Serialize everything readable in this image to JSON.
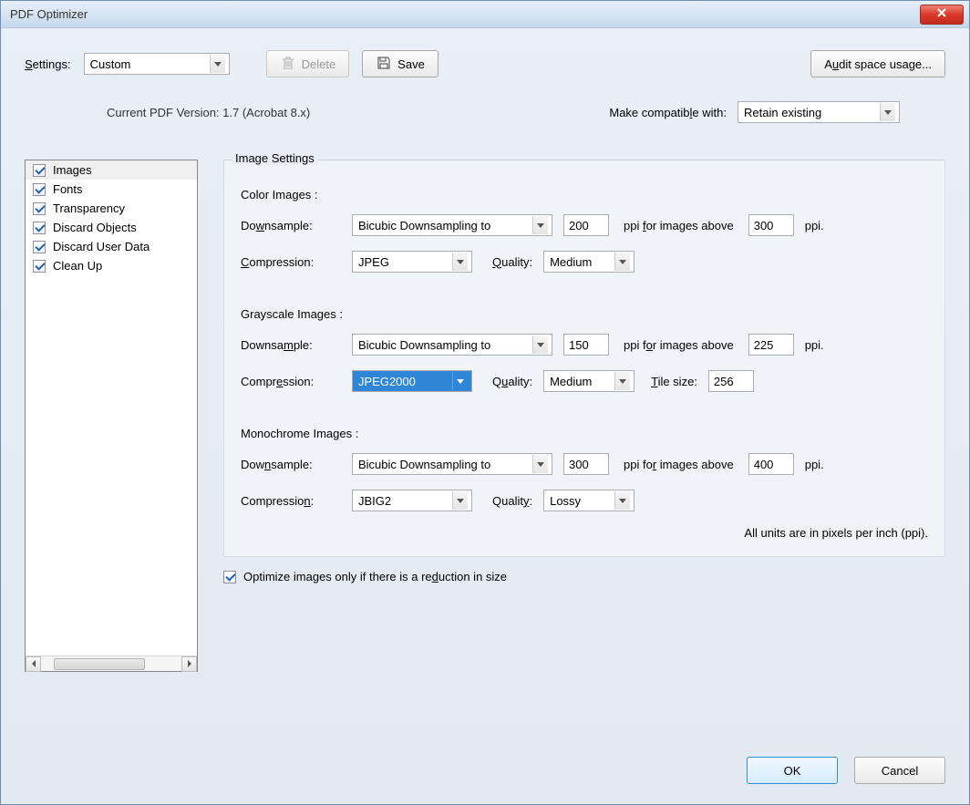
{
  "window": {
    "title": "PDF Optimizer"
  },
  "toolbar": {
    "settings_label": "Settings:",
    "settings_value": "Custom",
    "delete_label": "Delete",
    "save_label": "Save",
    "audit_label": "Audit space usage..."
  },
  "version": {
    "current_label": "Current PDF Version: 1.7 (Acrobat 8.x)",
    "compat_label": "Make compatible with:",
    "compat_value": "Retain existing"
  },
  "sidebar": {
    "items": [
      {
        "label": "Images",
        "checked": true,
        "selected": true
      },
      {
        "label": "Fonts",
        "checked": true,
        "selected": false
      },
      {
        "label": "Transparency",
        "checked": true,
        "selected": false
      },
      {
        "label": "Discard Objects",
        "checked": true,
        "selected": false
      },
      {
        "label": "Discard User Data",
        "checked": true,
        "selected": false
      },
      {
        "label": "Clean Up",
        "checked": true,
        "selected": false
      }
    ]
  },
  "panel": {
    "title": "Image Settings",
    "color": {
      "title": "Color Images :",
      "downsample_label": "Downsample:",
      "downsample_method": "Bicubic Downsampling to",
      "downsample_ppi": "200",
      "above_label": "ppi for images above",
      "above_ppi": "300",
      "ppi_suffix": "ppi.",
      "compression_label": "Compression:",
      "compression_value": "JPEG",
      "quality_label": "Quality:",
      "quality_value": "Medium"
    },
    "grayscale": {
      "title": "Grayscale Images :",
      "downsample_label": "Downsample:",
      "downsample_method": "Bicubic Downsampling to",
      "downsample_ppi": "150",
      "above_label": "ppi for images above",
      "above_ppi": "225",
      "ppi_suffix": "ppi.",
      "compression_label": "Compression:",
      "compression_value": "JPEG2000",
      "quality_label": "Quality:",
      "quality_value": "Medium",
      "tile_label": "Tile size:",
      "tile_value": "256"
    },
    "mono": {
      "title": "Monochrome Images :",
      "downsample_label": "Downsample:",
      "downsample_method": "Bicubic Downsampling to",
      "downsample_ppi": "300",
      "above_label": "ppi for images above",
      "above_ppi": "400",
      "ppi_suffix": "ppi.",
      "compression_label": "Compression:",
      "compression_value": "JBIG2",
      "quality_label": "Quality:",
      "quality_value": "Lossy"
    },
    "note": "All units are in pixels per inch (ppi).",
    "optimize_label": "Optimize images only if there is a reduction in size",
    "optimize_checked": true
  },
  "footer": {
    "ok": "OK",
    "cancel": "Cancel"
  }
}
